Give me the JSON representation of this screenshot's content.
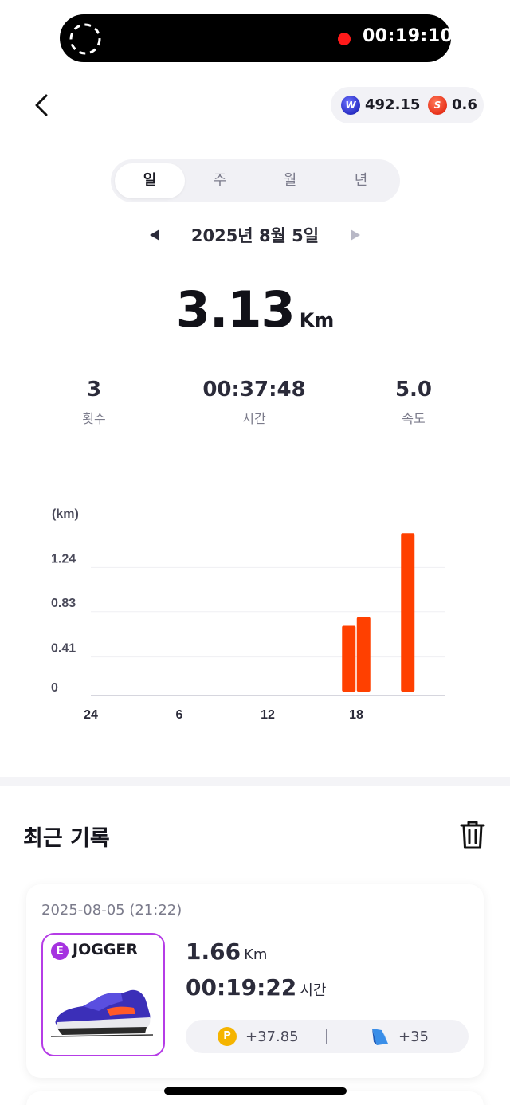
{
  "status_bar": {
    "recording_time": "00:19:10"
  },
  "header": {
    "balances": [
      {
        "icon": "w-coin-icon",
        "value": "492.15"
      },
      {
        "icon": "s-coin-icon",
        "value": "0.6"
      }
    ]
  },
  "period_tabs": [
    {
      "label": "일",
      "active": true
    },
    {
      "label": "주",
      "active": false
    },
    {
      "label": "월",
      "active": false
    },
    {
      "label": "년",
      "active": false
    }
  ],
  "date_nav": {
    "label": "2025년 8월 5일"
  },
  "summary": {
    "distance": "3.13",
    "distance_unit": "Km",
    "stats": [
      {
        "value": "3",
        "label": "횟수"
      },
      {
        "value": "00:37:48",
        "label": "시간"
      },
      {
        "value": "5.0",
        "label": "속도"
      }
    ]
  },
  "chart_data": {
    "type": "bar",
    "unit_label": "(km)",
    "y_ticks": [
      "1.24",
      "0.83",
      "0.41",
      "0"
    ],
    "x_ticks": [
      "24",
      "6",
      "12",
      "18"
    ],
    "ylim": [
      0,
      1.45
    ],
    "bars": [
      {
        "hour": 17.0,
        "value": 0.61
      },
      {
        "hour": 18.0,
        "value": 0.69
      },
      {
        "hour": 21.0,
        "value": 1.47
      }
    ],
    "color": "#ff4000"
  },
  "recent": {
    "title": "최근 기록",
    "records": [
      {
        "datetime": "2025-08-05 (21:22)",
        "grade": "E",
        "shoe_name": "JOGGER",
        "distance": "1.66",
        "distance_unit": "Km",
        "duration": "00:19:22",
        "duration_unit": "시간",
        "reward_points": "+37.85",
        "reward_map": "+35"
      }
    ]
  }
}
